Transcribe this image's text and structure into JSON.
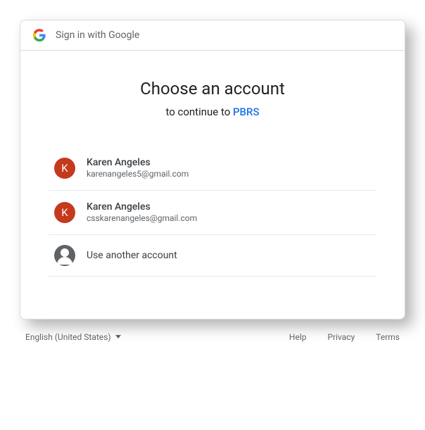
{
  "header": {
    "title": "Sign in with Google"
  },
  "main": {
    "title": "Choose an account",
    "subtitle_prefix": "to continue to ",
    "app_name": "PBRS"
  },
  "accounts": [
    {
      "initial": "K",
      "name": "Karen Angeles",
      "email": "karenangeles5@gmail.com"
    },
    {
      "initial": "K",
      "name": "Karen Angeles",
      "email": "csskarenangeles@gmail.com"
    }
  ],
  "other_account_label": "Use another account",
  "footer": {
    "language": "English (United States)",
    "help": "Help",
    "privacy": "Privacy",
    "terms": "Terms"
  }
}
